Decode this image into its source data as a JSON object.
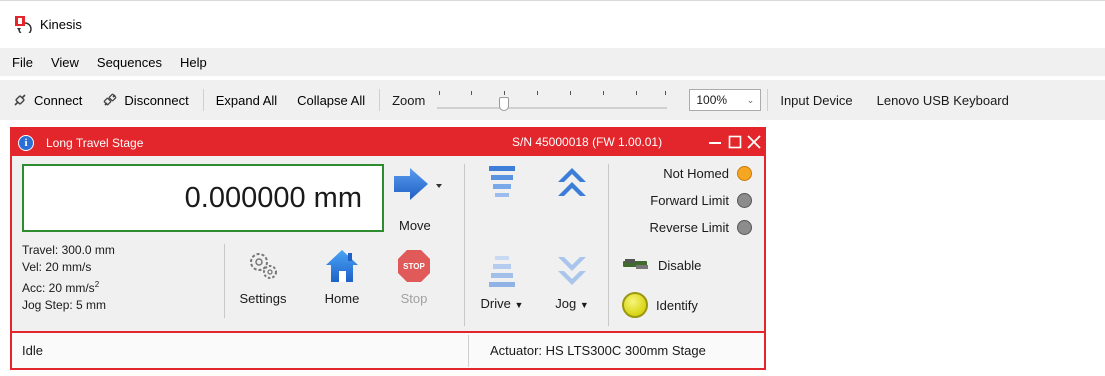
{
  "window": {
    "title": "Kinesis"
  },
  "menu": [
    "File",
    "View",
    "Sequences",
    "Help"
  ],
  "toolbar": {
    "connect": "Connect",
    "disconnect": "Disconnect",
    "expand_all": "Expand All",
    "collapse_all": "Collapse All",
    "zoom_label": "Zoom",
    "zoom_value": "100%",
    "input_device_label": "Input Device",
    "input_device_value": "Lenovo USB Keyboard"
  },
  "panel": {
    "title": "Long Travel Stage",
    "serial": "S/N 45000018 (FW 1.00.01)",
    "position": "0.000000 mm",
    "move_label": "Move",
    "stats": {
      "travel": "Travel: 300.0 mm",
      "vel": "Vel: 20 mm/s",
      "acc_prefix": "Acc: 20 mm/s",
      "acc_sup": "2",
      "jog_step": "Jog Step: 5 mm"
    },
    "buttons": {
      "settings": "Settings",
      "home": "Home",
      "stop": "Stop",
      "drive": "Drive",
      "jog": "Jog",
      "disable": "Disable",
      "identify": "Identify",
      "stop_icon_text": "STOP"
    },
    "status": {
      "not_homed": "Not Homed",
      "forward_limit": "Forward Limit",
      "reverse_limit": "Reverse Limit"
    },
    "statusbar": {
      "state": "Idle",
      "actuator": "Actuator:  HS LTS300C 300mm Stage"
    }
  },
  "colors": {
    "accent_red": "#e2262b",
    "readout_border": "#2e8b2e",
    "arrow_blue": "#2b6fd6",
    "not_homed_led": "#f5a623",
    "limit_led": "#8c8c8c",
    "identify_led": "#e6e31e"
  }
}
